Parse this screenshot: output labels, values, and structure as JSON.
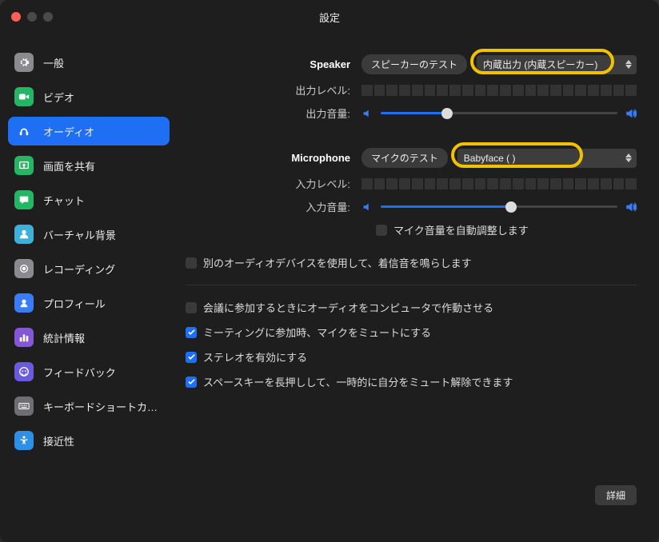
{
  "window": {
    "title": "設定"
  },
  "sidebar": {
    "items": [
      {
        "label": "一般",
        "icon": "gear",
        "bg": "#8a8a8f",
        "active": false
      },
      {
        "label": "ビデオ",
        "icon": "video",
        "bg": "#26b564",
        "active": false
      },
      {
        "label": "オーディオ",
        "icon": "headphones",
        "bg": "#1f6ff5",
        "active": true
      },
      {
        "label": "画面を共有",
        "icon": "share",
        "bg": "#26b564",
        "active": false
      },
      {
        "label": "チャット",
        "icon": "chat",
        "bg": "#26b564",
        "active": false
      },
      {
        "label": "バーチャル背景",
        "icon": "person",
        "bg": "#3fb0d8",
        "active": false
      },
      {
        "label": "レコーディング",
        "icon": "record",
        "bg": "#8a8a8f",
        "active": false
      },
      {
        "label": "プロフィール",
        "icon": "user",
        "bg": "#3a7cf6",
        "active": false
      },
      {
        "label": "統計情報",
        "icon": "stats",
        "bg": "#8357d6",
        "active": false
      },
      {
        "label": "フィードバック",
        "icon": "smile",
        "bg": "#695bdc",
        "active": false
      },
      {
        "label": "キーボードショートカ…",
        "icon": "keyboard",
        "bg": "#6e6e74",
        "active": false
      },
      {
        "label": "接近性",
        "icon": "accessibility",
        "bg": "#2e8fe6",
        "active": false
      }
    ]
  },
  "speaker": {
    "heading": "Speaker",
    "test_btn": "スピーカーのテスト",
    "device": "内蔵出力 (内蔵スピーカー)",
    "level_label": "出力レベル:",
    "volume_label": "出力音量:",
    "volume_pct": 28
  },
  "microphone": {
    "heading": "Microphone",
    "test_btn": "マイクのテスト",
    "device": "Babyface (             )",
    "level_label": "入力レベル:",
    "volume_label": "入力音量:",
    "volume_pct": 55,
    "auto_adjust": {
      "label": "マイク音量を自動調整します",
      "checked": false
    }
  },
  "ringtone": {
    "label": "別のオーディオデバイスを使用して、着信音を鳴らします",
    "checked": false
  },
  "options": [
    {
      "label": "会議に参加するときにオーディオをコンピュータで作動させる",
      "checked": false
    },
    {
      "label": "ミーティングに参加時、マイクをミュートにする",
      "checked": true
    },
    {
      "label": "ステレオを有効にする",
      "checked": true
    },
    {
      "label": "スペースキーを長押しして、一時的に自分をミュート解除できます",
      "checked": true
    }
  ],
  "advanced_btn": "詳細"
}
